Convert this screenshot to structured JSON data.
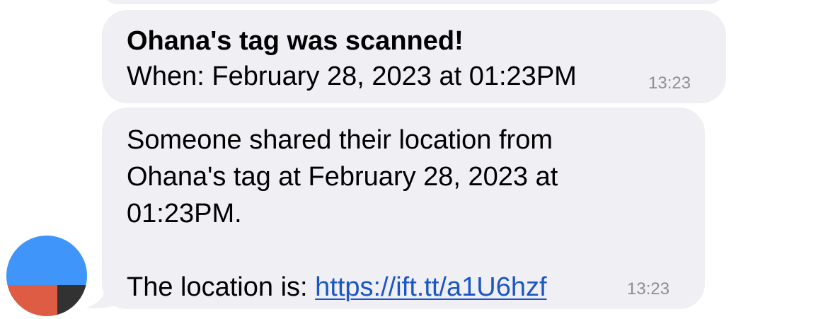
{
  "messages": [
    {
      "title": "Ohana's tag was scanned!",
      "body": "When: February 28, 2023 at 01:23PM",
      "time": "13:23"
    },
    {
      "body": "Someone shared their location from\nOhana's tag at February 28, 2023 at\n01:23PM.",
      "link_prefix": "The location is: ",
      "link_text": "https://ift.tt/a1U6hzf",
      "time": "13:23"
    }
  ],
  "colors": {
    "bubble_bg": "#efeff4",
    "link": "#1a56c4",
    "timestamp": "#8e8e93",
    "avatar_blue": "#3f95f9",
    "avatar_red": "#de5b44",
    "avatar_dark": "#323232"
  }
}
